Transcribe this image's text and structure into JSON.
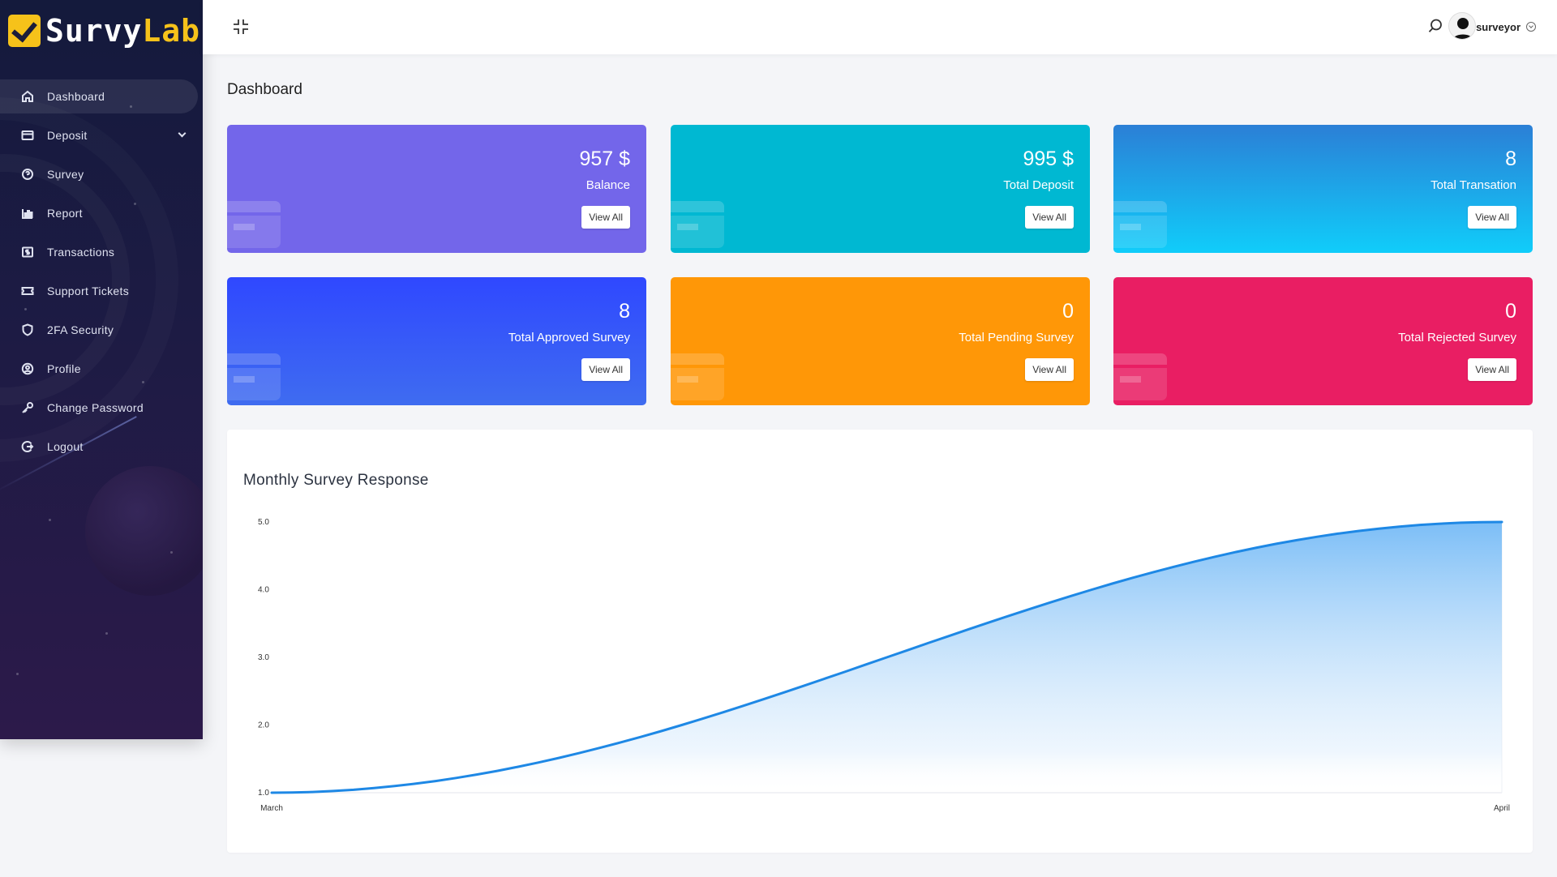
{
  "brand": {
    "name_part1": "Survy",
    "name_part2": "Lab",
    "accent": "#f6c21a"
  },
  "sidebar": {
    "items": [
      {
        "label": "Dashboard",
        "icon": "home-icon",
        "active": true
      },
      {
        "label": "Deposit",
        "icon": "credit-card-icon",
        "has_submenu": true
      },
      {
        "label": "Survey",
        "icon": "question-circle-icon"
      },
      {
        "label": "Report",
        "icon": "bar-chart-icon"
      },
      {
        "label": "Transactions",
        "icon": "dollar-receipt-icon"
      },
      {
        "label": "Support Tickets",
        "icon": "ticket-icon"
      },
      {
        "label": "2FA Security",
        "icon": "shield-icon"
      },
      {
        "label": "Profile",
        "icon": "user-circle-icon"
      },
      {
        "label": "Change Password",
        "icon": "key-icon"
      },
      {
        "label": "Logout",
        "icon": "logout-icon"
      }
    ]
  },
  "header": {
    "username": "surveyor"
  },
  "page_title": "Dashboard",
  "cards": [
    {
      "value": "957 $",
      "label": "Balance",
      "button": "View All",
      "color": "#7366ea"
    },
    {
      "value": "995 $",
      "label": "Total Deposit",
      "button": "View All",
      "color": "#00b8d2"
    },
    {
      "value": "8",
      "label": "Total Transation",
      "button": "View All",
      "color": "#10cdfa"
    },
    {
      "value": "8",
      "label": "Total Approved Survey",
      "button": "View All",
      "color": "#2f48ff"
    },
    {
      "value": "0",
      "label": "Total Pending Survey",
      "button": "View All",
      "color": "#ff9707"
    },
    {
      "value": "0",
      "label": "Total Rejected Survey",
      "button": "View All",
      "color": "#e91e63"
    }
  ],
  "chart_title": "Monthly Survey Response",
  "chart_data": {
    "type": "area",
    "categories": [
      "March",
      "April"
    ],
    "values": [
      1.0,
      5.0
    ],
    "yticks": [
      "1.0",
      "2.0",
      "3.0",
      "4.0",
      "5.0"
    ],
    "ylim": [
      1.0,
      5.0
    ],
    "line_color": "#1e88e5",
    "title": "Monthly Survey Response",
    "xlabel": "",
    "ylabel": ""
  }
}
